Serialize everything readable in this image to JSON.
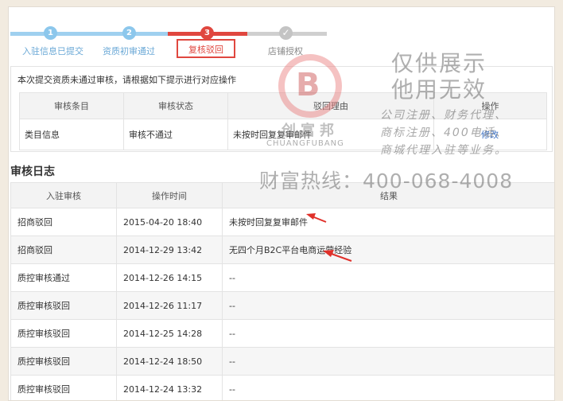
{
  "steps": [
    {
      "num": "1",
      "label": "入驻信息已提交"
    },
    {
      "num": "2",
      "label": "资质初审通过"
    },
    {
      "num": "3",
      "label": "复核驳回"
    },
    {
      "num": "✓",
      "label": "店铺授权"
    }
  ],
  "result": {
    "notice": "本次提交资质未通过审核，请根据如下提示进行对应操作",
    "headers": [
      "审核条目",
      "审核状态",
      "驳回理由",
      "操作"
    ],
    "row": {
      "item": "类目信息",
      "status": "审核不通过",
      "reason": "未按时回复复审邮件",
      "action": "修改"
    }
  },
  "log": {
    "title": "审核日志",
    "headers": [
      "入驻审核",
      "操作时间",
      "结果"
    ],
    "rows": [
      {
        "type": "招商驳回",
        "time": "2015-04-20 18:40",
        "result": "未按时回复复审邮件"
      },
      {
        "type": "招商驳回",
        "time": "2014-12-29 13:42",
        "result": "无四个月B2C平台电商运营经验"
      },
      {
        "type": "质控审核通过",
        "time": "2014-12-26 14:15",
        "result": "--"
      },
      {
        "type": "质控审核驳回",
        "time": "2014-12-26 11:17",
        "result": "--"
      },
      {
        "type": "质控审核驳回",
        "time": "2014-12-25 14:28",
        "result": "--"
      },
      {
        "type": "质控审核驳回",
        "time": "2014-12-24 18:50",
        "result": "--"
      },
      {
        "type": "质控审核驳回",
        "time": "2014-12-24 13:32",
        "result": "--"
      }
    ]
  },
  "watermark": {
    "logo_name": "创富邦",
    "logo_en": "CHUANGFUBANG",
    "line1": "仅供展示",
    "line2": "他用无效",
    "small1": "公司注册、财务代理、",
    "small2": "商标注册、400电话、",
    "small3": "商城代理入驻等业务。",
    "hotline": "财富热线：400-068-4008"
  },
  "colors": {
    "accent_red": "#e0473f",
    "done_blue": "#8cc7ec",
    "link_blue": "#3a6fc2"
  },
  "icons": [
    "arrow-annotation-icon"
  ]
}
